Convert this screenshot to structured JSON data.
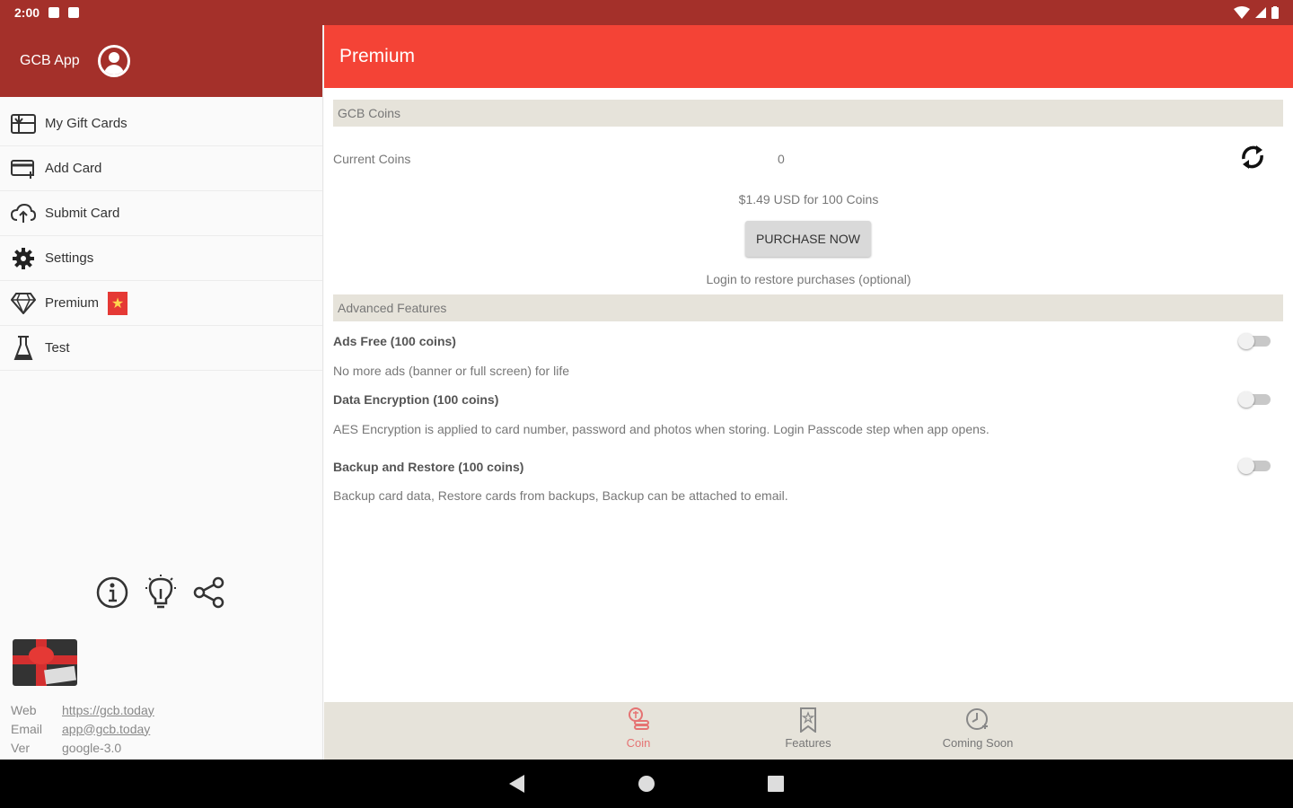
{
  "status": {
    "time": "2:00"
  },
  "drawer": {
    "app_name": "GCB App",
    "items": [
      {
        "label": "My Gift Cards",
        "icon": "gift-card-icon"
      },
      {
        "label": "Add Card",
        "icon": "add-card-icon"
      },
      {
        "label": "Submit Card",
        "icon": "cloud-upload-icon"
      },
      {
        "label": "Settings",
        "icon": "gear-icon"
      },
      {
        "label": "Premium",
        "icon": "diamond-icon"
      },
      {
        "label": "Test",
        "icon": "flask-icon"
      }
    ],
    "premium_badge_icon": "star-icon",
    "footer_icons": [
      "info-icon",
      "lightbulb-icon",
      "share-icon"
    ],
    "contact": {
      "web_label": "Web",
      "web_value": "https://gcb.today",
      "email_label": "Email",
      "email_value": "app@gcb.today",
      "ver_label": "Ver",
      "ver_value": "google-3.0"
    }
  },
  "app_bar": {
    "title": "Premium"
  },
  "coins": {
    "section_title": "GCB Coins",
    "current_label": "Current Coins",
    "current_value": "0",
    "price_text": "$1.49 USD for 100 Coins",
    "purchase_label": "PURCHASE NOW",
    "restore_text": "Login to restore purchases (optional)"
  },
  "features": {
    "section_title": "Advanced Features",
    "items": [
      {
        "title": "Ads Free (100 coins)",
        "desc": "No more ads (banner or full screen) for life",
        "enabled": false
      },
      {
        "title": "Data Encryption (100 coins)",
        "desc": "AES Encryption is applied to card number, password and photos when storing. Login Passcode step when app opens.",
        "enabled": false
      },
      {
        "title": "Backup and Restore (100 coins)",
        "desc": "Backup card data, Restore cards from backups, Backup can be attached to email.",
        "enabled": false
      }
    ]
  },
  "bottom_nav": {
    "items": [
      {
        "label": "Coin",
        "icon": "coin-icon",
        "active": true
      },
      {
        "label": "Features",
        "icon": "ribbon-icon",
        "active": false
      },
      {
        "label": "Coming Soon",
        "icon": "clock-icon",
        "active": false
      }
    ]
  },
  "colors": {
    "status_bar": "#a4302a",
    "app_bar": "#f44336",
    "section_bg": "#e6e3da",
    "active_nav": "#e57373"
  }
}
